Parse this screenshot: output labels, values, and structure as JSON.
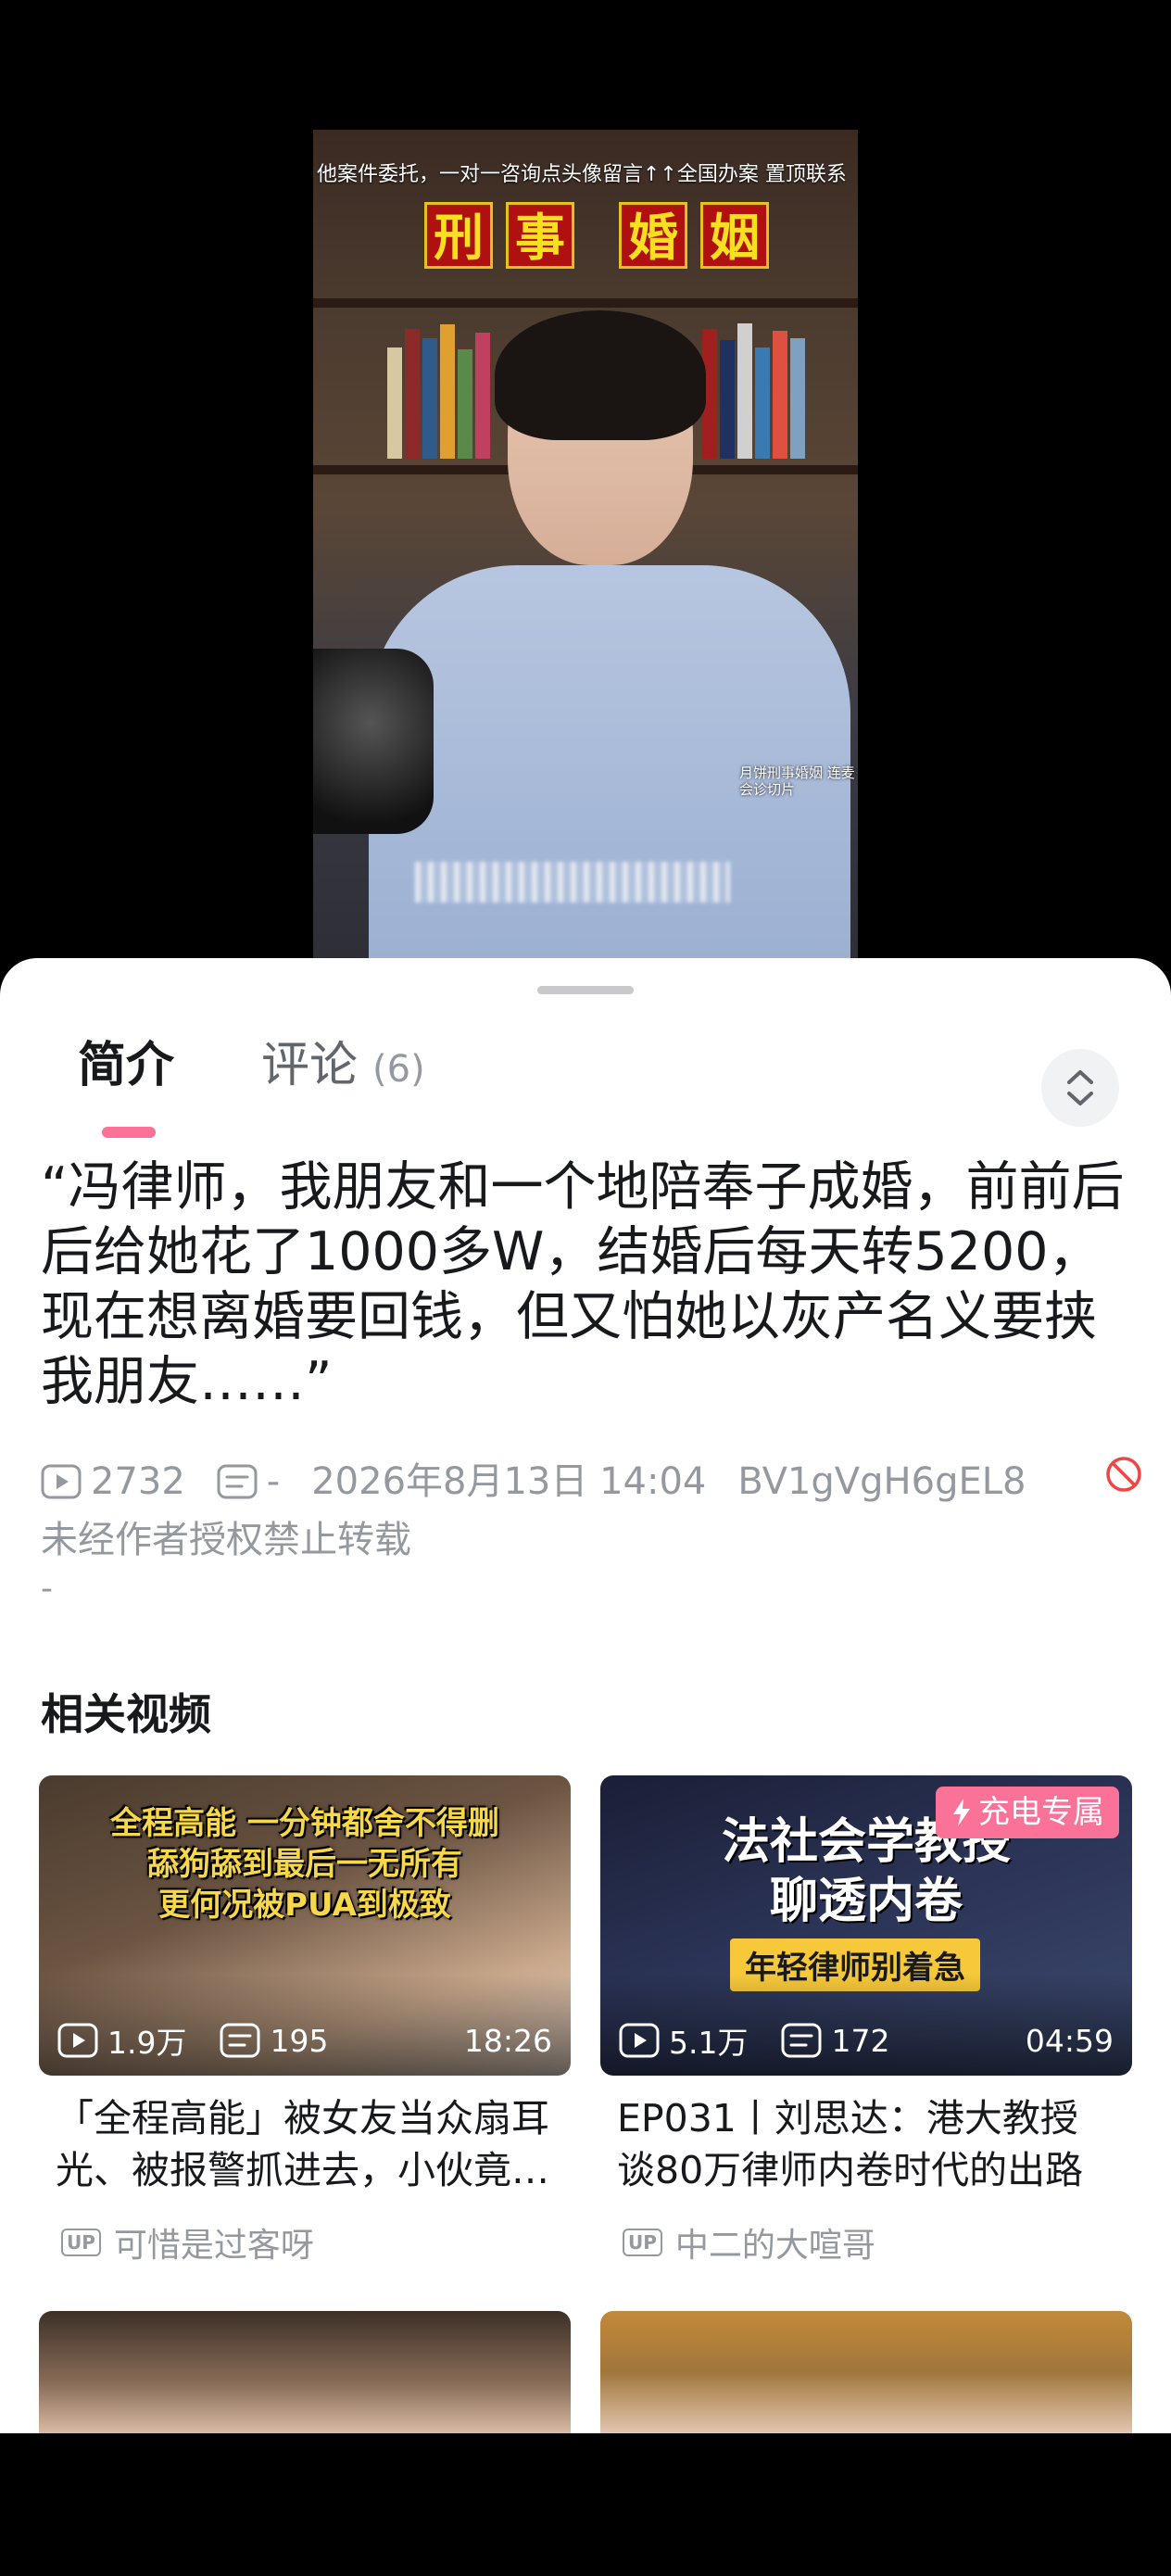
{
  "video": {
    "ticker": "他案件委托，一对一咨询点头像留言↑↑全国办案 置顶联系",
    "sign_chars": [
      "刑",
      "事",
      "婚",
      "姻"
    ],
    "watermark": "月饼刑事婚姻 连麦会诊切片"
  },
  "tabs": {
    "intro": "简介",
    "comments": "评论",
    "comments_count": "(6)"
  },
  "video_info": {
    "title": "“冯律师，我朋友和一个地陪奉子成婚，前前后后给她花了1000多W，结婚后每天转5200，现在想离婚要回钱，但又怕她以灰产名义要挟我朋友……”",
    "views": "2732",
    "danmaku": "-",
    "datetime": "2026年8月13日 14:04",
    "bvid": "BV1gVgH6gEL8",
    "repost_notice": "未经作者授权禁止转载",
    "description": "-"
  },
  "related": {
    "heading": "相关视频",
    "items": [
      {
        "caption": [
          "全程高能  一分钟都舍不得删",
          "舔狗舔到最后一无所有",
          "更何况被PUA到极致"
        ],
        "views": "1.9万",
        "danmaku": "195",
        "duration": "18:26",
        "title": "「全程高能」被女友当众扇耳光、被报警抓进去，小伙竟然还要维护她",
        "uploader": "可惜是过客呀",
        "up_tag": "UP"
      },
      {
        "badge": "充电专属",
        "caption": [
          "法社会学教授",
          "聊透内卷"
        ],
        "caption_tag": "年轻律师别着急",
        "views": "5.1万",
        "danmaku": "172",
        "duration": "04:59",
        "title": "EP031丨刘思达：港大教授谈80万律师内卷时代的出路",
        "uploader": "中二的大喧哥",
        "up_tag": "UP"
      }
    ]
  },
  "colors": {
    "accent": "#fb7299",
    "text_primary": "#18191c",
    "text_secondary": "#9499a0"
  }
}
